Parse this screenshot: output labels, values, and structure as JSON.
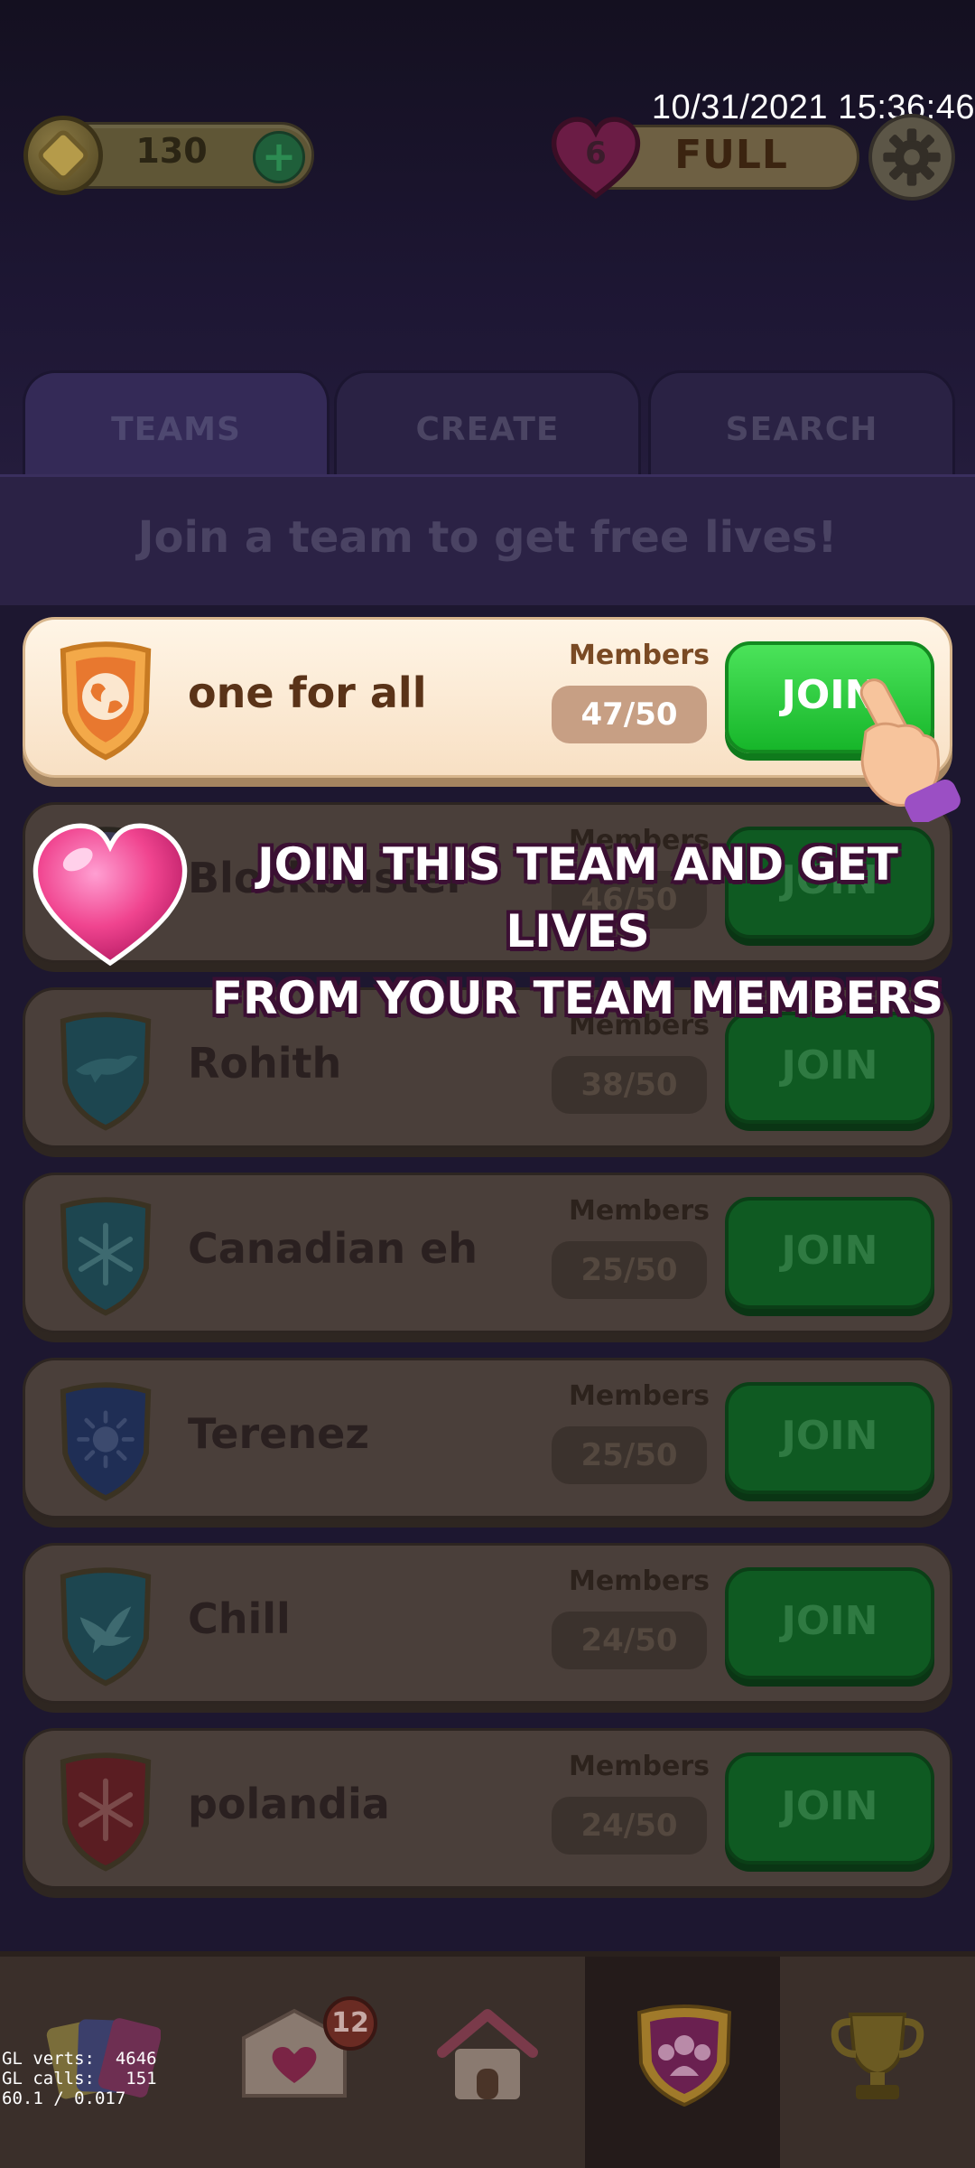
{
  "status": {
    "timestamp": "10/31/2021 15:36:46"
  },
  "header": {
    "coins": "130",
    "coins_plus": "+",
    "lives_count": "6",
    "lives_status": "FULL"
  },
  "tabs": [
    {
      "label": "TEAMS"
    },
    {
      "label": "CREATE"
    },
    {
      "label": "SEARCH"
    }
  ],
  "banner": {
    "text": "Join a team to get free lives!"
  },
  "members_label": "Members",
  "join_label": "JOIN",
  "teams": [
    {
      "name": "one for all",
      "members": "47/50",
      "badge_icon": "globe-icon",
      "badge_color": "#f09a3e"
    },
    {
      "name": "Blockbuster",
      "members": "46/50",
      "badge_icon": "star-icon",
      "badge_color": "#3b3a55"
    },
    {
      "name": "Rohith",
      "members": "38/50",
      "badge_icon": "panther-icon",
      "badge_color": "#1d4650"
    },
    {
      "name": "Canadian eh",
      "members": "25/50",
      "badge_icon": "snowflake-icon",
      "badge_color": "#1d4650"
    },
    {
      "name": "Terenez",
      "members": "25/50",
      "badge_icon": "sun-icon",
      "badge_color": "#1f2e55"
    },
    {
      "name": "Chill",
      "members": "24/50",
      "badge_icon": "bird-icon",
      "badge_color": "#1d4650"
    },
    {
      "name": "polandia",
      "members": "24/50",
      "badge_icon": "snowflake-icon",
      "badge_color": "#5a1d22"
    }
  ],
  "tutorial": {
    "line1": "JOIN THIS TEAM AND GET LIVES",
    "line2": "FROM YOUR TEAM MEMBERS"
  },
  "nav": {
    "mail_badge": "12",
    "items": [
      "cards-icon",
      "mail-icon",
      "home-icon",
      "team-icon",
      "trophy-icon"
    ]
  },
  "debug": {
    "line1": "GL verts:  4646",
    "line2": "GL calls:   151",
    "line3": "60.1 / 0.017"
  },
  "colors": {
    "join_active": "#17b62a",
    "join_dim": "#0f5a22",
    "card_highlight": "#fff5e6"
  }
}
